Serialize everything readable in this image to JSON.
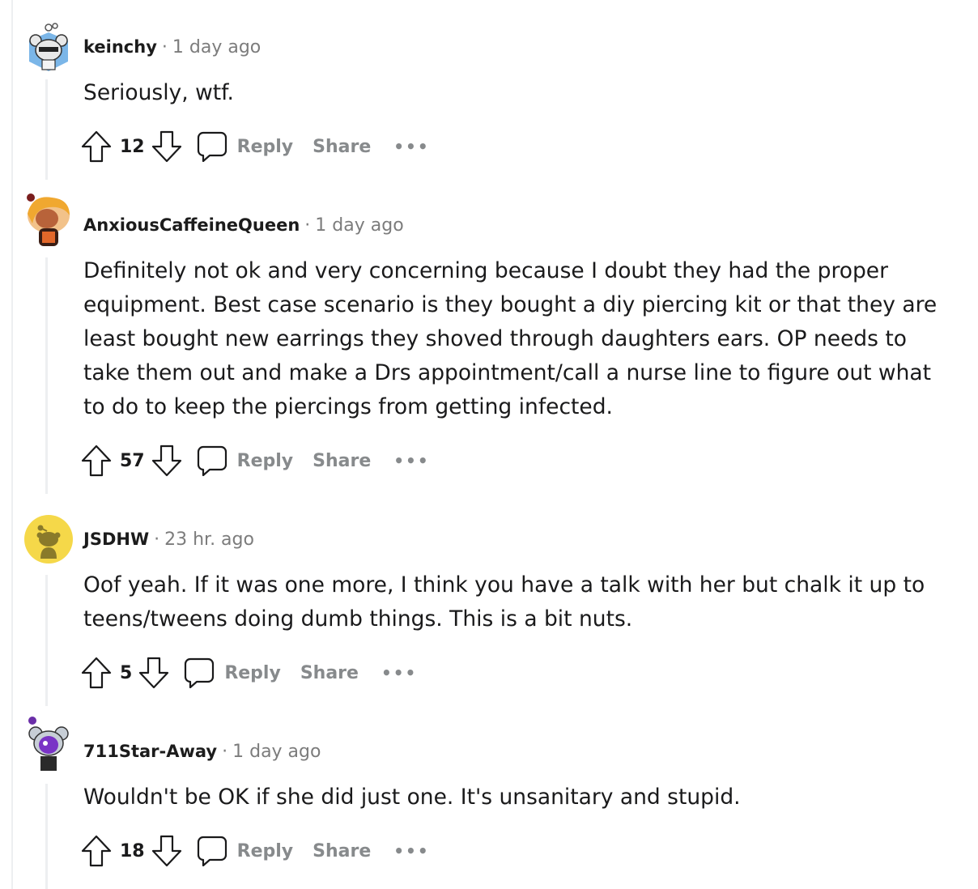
{
  "colors": {
    "thread_line": "#edeff1",
    "meta_gray": "#7c7c7c",
    "action_gray": "#878a8c",
    "text": "#1a1a1b",
    "avatar_yellow": "#f5d849"
  },
  "actions": {
    "reply_label": "Reply",
    "share_label": "Share",
    "upvote_icon": "arrow-up-outline-icon",
    "downvote_icon": "arrow-down-outline-icon",
    "reply_icon": "speech-bubble-icon",
    "more_icon": "ellipsis-icon"
  },
  "comments": [
    {
      "username": "keinchy",
      "time": "1 day ago",
      "body": [
        "Seriously, wtf."
      ],
      "score": "12",
      "avatar": "snoo-blue-avatar-icon"
    },
    {
      "username": "AnxiousCaffeineQueen",
      "time": "1 day ago",
      "body": [
        "Definitely not ok and very concerning because I doubt they had the proper",
        "equipment. Best case scenario is they bought a diy piercing kit or that they are",
        "least bought new earrings they shoved through daughters ears. OP needs to",
        "take them out and make a Drs appointment/call a nurse line to figure out what",
        "to do to keep the piercings from getting infected."
      ],
      "score": "57",
      "avatar": "snoo-brown-hair-avatar-icon"
    },
    {
      "username": "JSDHW",
      "time": "23 hr. ago",
      "body": [
        "Oof yeah. If it was one more, I think you have a talk with her but chalk it up to",
        "teens/tweens doing dumb things. This is a bit nuts."
      ],
      "score": "5",
      "avatar": "snoo-default-yellow-avatar-icon"
    },
    {
      "username": "711Star-Away",
      "time": "1 day ago",
      "body": [
        "Wouldn't be OK if she did just one. It's unsanitary and stupid."
      ],
      "score": "18",
      "avatar": "snoo-purple-avatar-icon"
    }
  ]
}
